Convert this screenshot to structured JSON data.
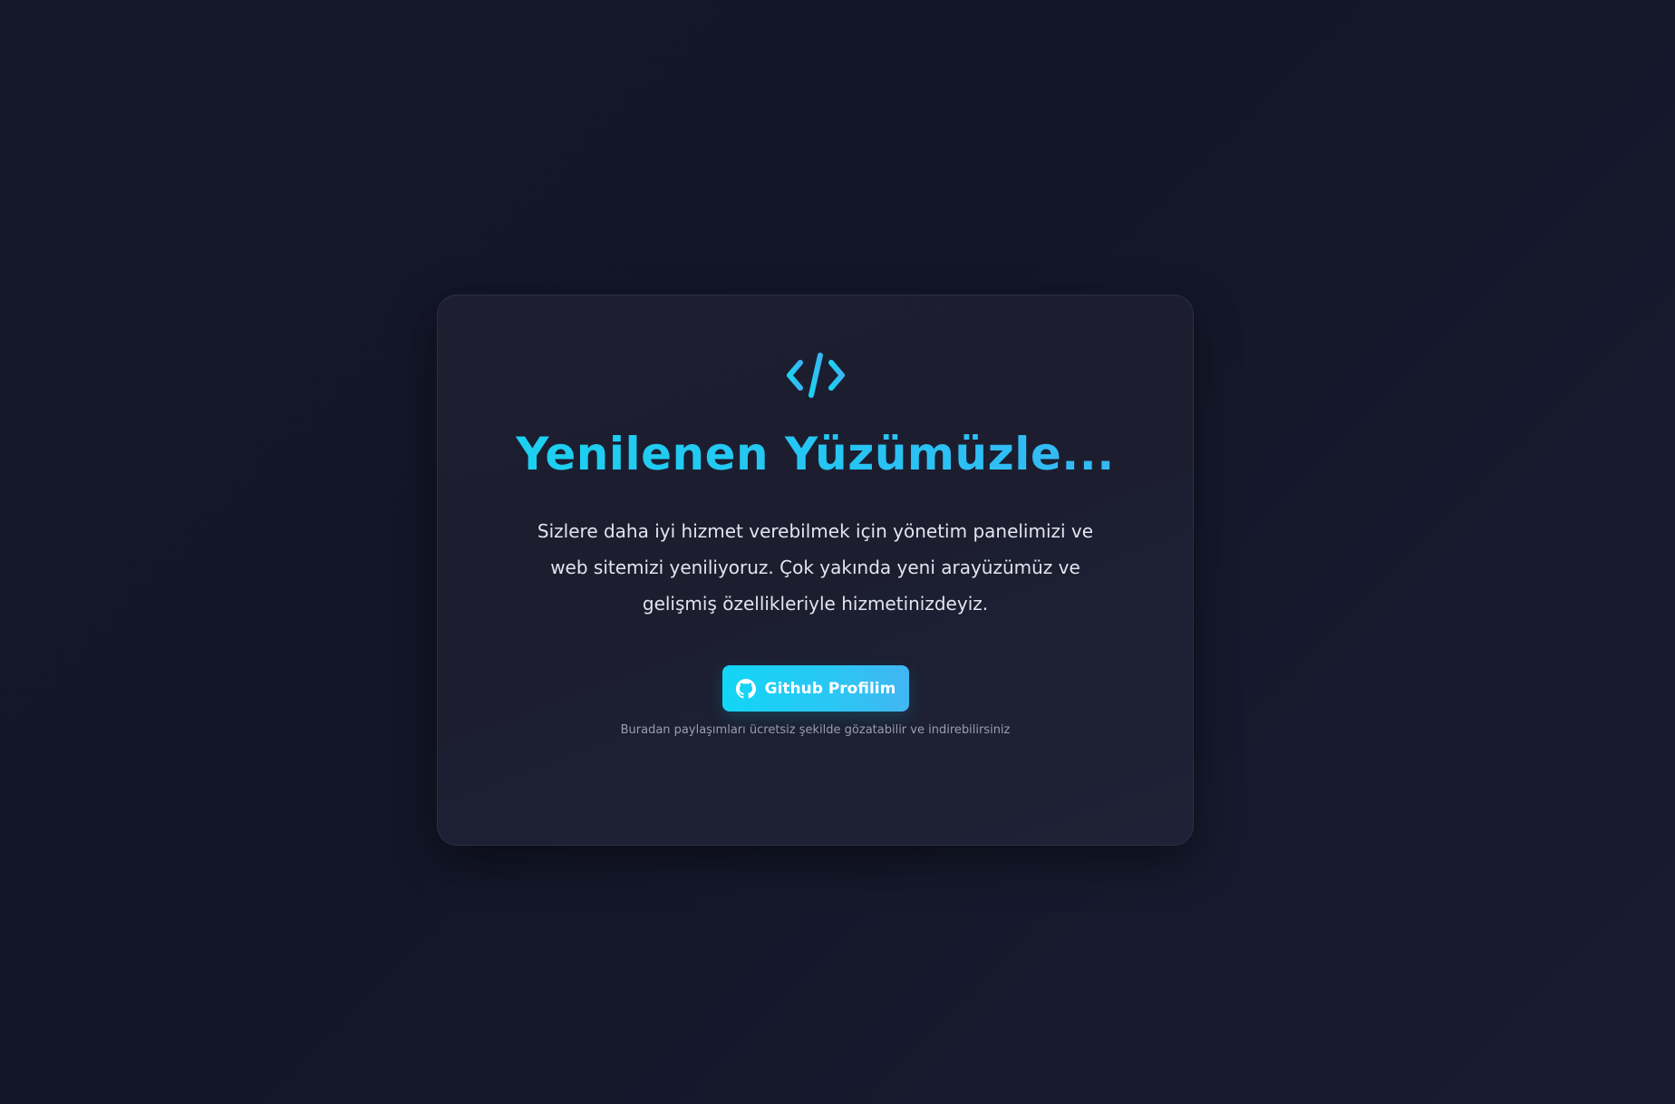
{
  "colors": {
    "background": "#14172a",
    "card": "#1d1f31",
    "accent": "#1ad3f0",
    "accent_end": "#3ab5f5",
    "text": "#e2e4ee",
    "muted": "#9a9db0"
  },
  "card": {
    "logo_icon": "code-icon",
    "title": "Yenilenen Yüzümüzle...",
    "description": "Sizlere daha iyi hizmet verebilmek için yönetim panelimizi ve web sitemizi yeniliyoruz. Çok yakında yeni arayüzümüz ve gelişmiş özellikleriyle hizmetinizdeyiz.",
    "button": {
      "icon": "github-icon",
      "label": "Github Profilim"
    },
    "note": "Buradan paylaşımları ücretsiz şekilde gözatabilir ve indirebilirsiniz"
  }
}
